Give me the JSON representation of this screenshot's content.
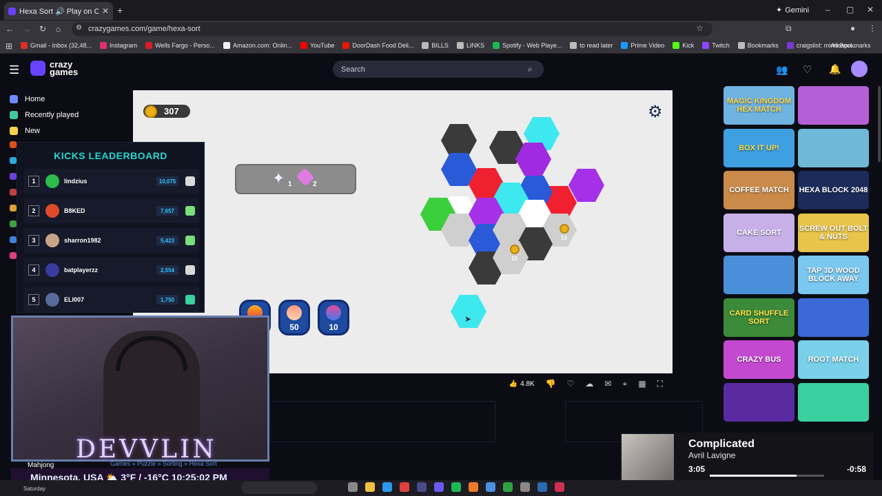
{
  "browser": {
    "tab_title": "Hexa Sort 🔊 Play on Crazy",
    "gemini_label": "Gemini",
    "url": "crazygames.com/game/hexa-sort",
    "bookmarks": [
      {
        "label": "Gmail - Inbox (32,48...",
        "color": "#d93025"
      },
      {
        "label": "Instagram",
        "color": "#e1306c"
      },
      {
        "label": "Wells Fargo - Perso...",
        "color": "#d71e28"
      },
      {
        "label": "Amazon.com: Onlin...",
        "color": "#f0f0f0"
      },
      {
        "label": "YouTube",
        "color": "#ff0000"
      },
      {
        "label": "DoorDash Food Deli...",
        "color": "#eb1700"
      },
      {
        "label": "BILLS",
        "color": "#bbbbbb"
      },
      {
        "label": "LINKS",
        "color": "#bbbbbb"
      },
      {
        "label": "Spotify - Web Playe...",
        "color": "#1db954"
      },
      {
        "label": "to read later",
        "color": "#bbbbbb"
      },
      {
        "label": "Prime Video",
        "color": "#1a98ff"
      },
      {
        "label": "Kick",
        "color": "#53fc18"
      },
      {
        "label": "Twitch",
        "color": "#9146ff"
      },
      {
        "label": "Bookmarks",
        "color": "#bbbbbb"
      },
      {
        "label": "craigslist: minneapo...",
        "color": "#7a3bd0"
      }
    ],
    "all_bookmarks": "All Bookmarks"
  },
  "site": {
    "logo_line1": "crazy",
    "logo_line2": "games",
    "search_placeholder": "Search",
    "sidebar": [
      {
        "label": "Home",
        "color": "#6b8cff"
      },
      {
        "label": "Recently played",
        "color": "#47c9a0"
      },
      {
        "label": "New",
        "color": "#f5d24a"
      }
    ],
    "crumbs": "Games » Puzzle » Sorting » Hexa Sort",
    "sidebar_bottom": "Mahjong",
    "sidebar_saturday": "Saturday"
  },
  "game": {
    "coins": "307",
    "goal_1": "1",
    "goal_2": "2",
    "boosters": [
      {
        "label": "",
        "color": "#1e4aa0"
      },
      {
        "label": "50",
        "color": "#1e4aa0"
      },
      {
        "label": "10",
        "color": "#1e4aa0"
      }
    ],
    "tile_costs": [
      "15",
      "15"
    ],
    "likes": "4.8K"
  },
  "leaderboard": {
    "title": "KICKS LEADERBOARD",
    "rows": [
      {
        "rank": "1",
        "name": "lindzius",
        "score": "10,075",
        "avatar": "#2dbb4a",
        "badge": "#d9d9d9"
      },
      {
        "rank": "2",
        "name": "B8KED",
        "score": "7,657",
        "avatar": "#e04a2a",
        "badge": "#7adf7a"
      },
      {
        "rank": "3",
        "name": "sharron1982",
        "score": "5,423",
        "avatar": "#c9a48a",
        "badge": "#7adf7a"
      },
      {
        "rank": "4",
        "name": "batplayerzz",
        "score": "2,554",
        "avatar": "#3a3aa0",
        "badge": "#d9d9d9"
      },
      {
        "rank": "5",
        "name": "ELI007",
        "score": "1,750",
        "avatar": "#5a6a9a",
        "badge": "#3ad0a0"
      }
    ]
  },
  "stream": {
    "name": "DEVVLIN",
    "weather": "Minnesota, USA ⛅ 3°F / -16°C  10:25:02 PM"
  },
  "games_grid": [
    {
      "label": "MAGIC KINGDOM HEX MATCH",
      "bg": "#6fb3e0",
      "fg": "#ffd84a"
    },
    {
      "label": "",
      "bg": "#b45fd6",
      "fg": "#fff"
    },
    {
      "label": "BOX IT UP!",
      "bg": "#3fa0e0",
      "fg": "#ffe14a"
    },
    {
      "label": "",
      "bg": "#6fb8d8",
      "fg": "#fff"
    },
    {
      "label": "COFFEE MATCH",
      "bg": "#c98a4a",
      "fg": "#fff"
    },
    {
      "label": "HEXA BLOCK 2048",
      "bg": "#1c2b5a",
      "fg": "#fff"
    },
    {
      "label": "CAKE SORT",
      "bg": "#c7b0e8",
      "fg": "#fff"
    },
    {
      "label": "SCREW OUT BOLT & NUTS",
      "bg": "#e8c44a",
      "fg": "#ffffff"
    },
    {
      "label": "",
      "bg": "#4a90d9",
      "fg": "#fff"
    },
    {
      "label": "TAP 3D WOOD BLOCK AWAY",
      "bg": "#7ac8ef",
      "fg": "#fff"
    },
    {
      "label": "CARD SHUFFLE SORT",
      "bg": "#3a8a3a",
      "fg": "#ffe14a"
    },
    {
      "label": "",
      "bg": "#3a6ad8",
      "fg": "#fff"
    },
    {
      "label": "CRAZY BUS",
      "bg": "#c34ad0",
      "fg": "#fff"
    },
    {
      "label": "ROOT MATCH",
      "bg": "#7ad0e8",
      "fg": "#fff"
    },
    {
      "label": "",
      "bg": "#5a2aa0",
      "fg": "#fff"
    },
    {
      "label": "",
      "bg": "#3ad0a0",
      "fg": "#fff"
    }
  ],
  "music": {
    "title": "Complicated",
    "artist": "Avril Lavigne",
    "elapsed": "3:05",
    "remaining": "-0:58",
    "progress": 0.76
  }
}
